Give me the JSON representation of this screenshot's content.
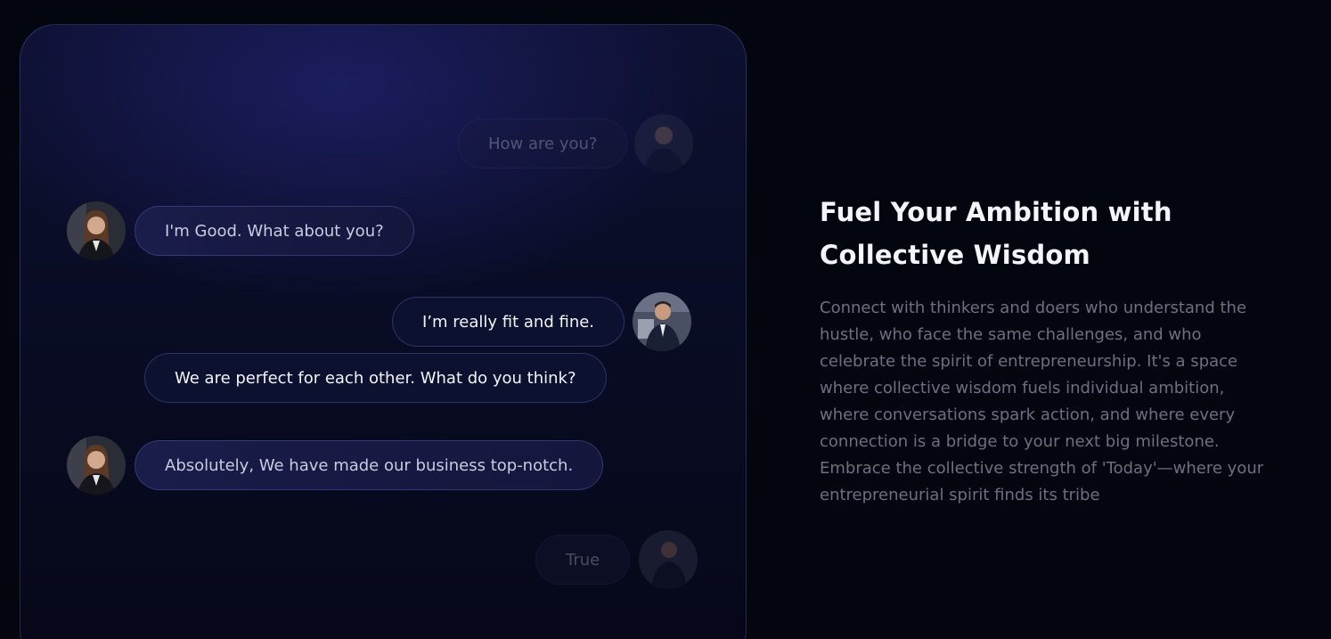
{
  "chat": {
    "messages": [
      {
        "text": "How are you?",
        "side": "right",
        "avatar": "man-avatar",
        "faded": true
      },
      {
        "text": "I'm Good. What about you?",
        "side": "left",
        "avatar": "woman-avatar",
        "faded": false
      },
      {
        "text": "I’m really fit and fine.",
        "side": "right",
        "avatar": "man-avatar",
        "faded": false
      },
      {
        "text": "We are perfect for each other. What do you think?",
        "side": "right",
        "avatar": null,
        "faded": false
      },
      {
        "text": "Absolutely, We have made our business top-notch.",
        "side": "left",
        "avatar": "woman-avatar",
        "faded": false
      },
      {
        "text": "True",
        "side": "right",
        "avatar": "man-avatar",
        "faded": true
      }
    ]
  },
  "feature": {
    "title_line1": "Fuel Your Ambition with",
    "title_line2": "Collective Wisdom",
    "description": "Connect with thinkers and doers who understand the hustle, who face the same challenges, and who celebrate the spirit of entrepreneurship. It's a space where collective wisdom fuels individual ambition, where conversations spark action, and where every connection is a bridge to your next big milestone. Embrace the collective strength of 'Today'—where your entrepreneurial spirit finds its tribe"
  },
  "colors": {
    "page_background": "#04060f",
    "card_glow": "#20226e",
    "incoming_bubble": "#1a1c4a",
    "outgoing_bubble": "#0d1130",
    "heading": "#f4f5fa",
    "body": "#6c6f82"
  }
}
